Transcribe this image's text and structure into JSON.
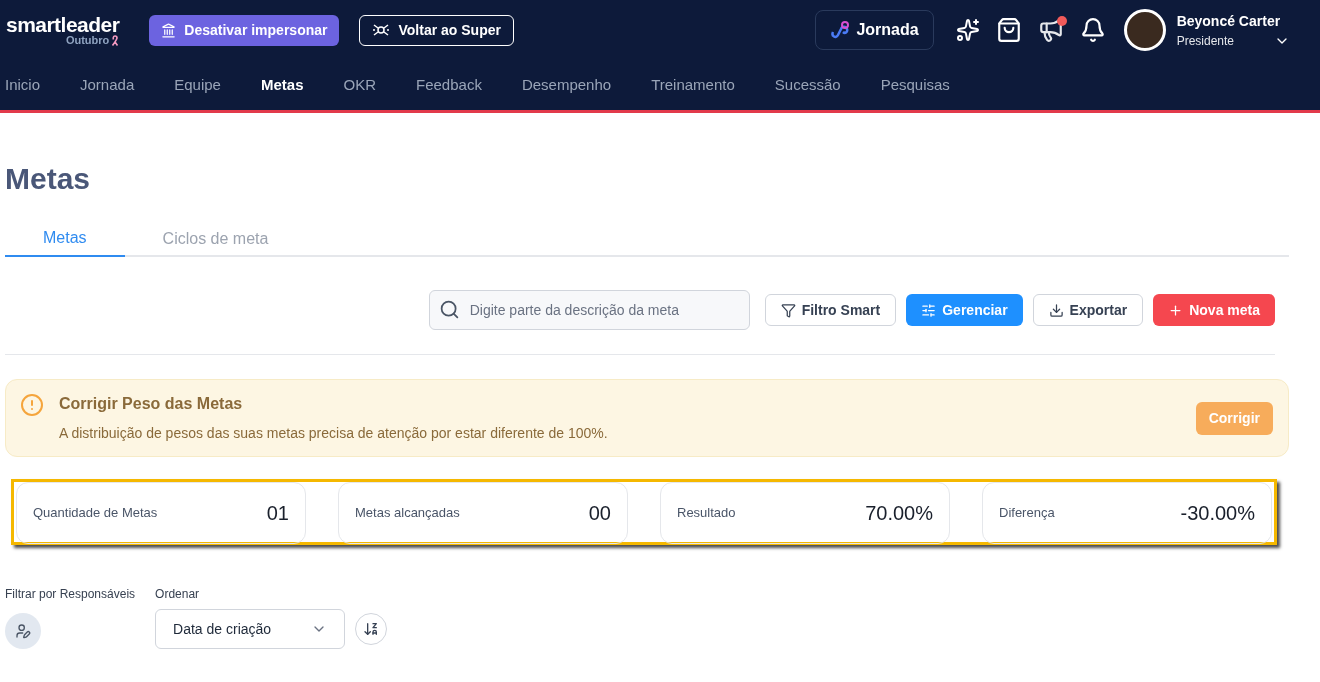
{
  "header": {
    "logo": "smartleader",
    "month": "Outubro",
    "buttons": [
      {
        "label": "Desativar impersonar",
        "kind": "primary"
      },
      {
        "label": "Voltar ao Super",
        "kind": "outline"
      }
    ],
    "journey_button": "Jornada",
    "announcement_unread": true,
    "user": {
      "name": "Beyoncé Carter",
      "role": "Presidente"
    }
  },
  "nav": [
    {
      "label": "Inicio",
      "selected": false
    },
    {
      "label": "Jornada",
      "selected": false
    },
    {
      "label": "Equipe",
      "selected": false
    },
    {
      "label": "Metas",
      "selected": true
    },
    {
      "label": "OKR",
      "selected": false
    },
    {
      "label": "Feedback",
      "selected": false
    },
    {
      "label": "Desempenho",
      "selected": false
    },
    {
      "label": "Treinamento",
      "selected": false
    },
    {
      "label": "Sucessão",
      "selected": false
    },
    {
      "label": "Pesquisas",
      "selected": false
    }
  ],
  "page_title": "Metas",
  "tabs": [
    {
      "label": "Metas",
      "selected": true
    },
    {
      "label": "Ciclos de meta",
      "selected": false
    }
  ],
  "toolbar": {
    "search": {
      "placeholder": "Digite parte da descrição da meta"
    },
    "buttons": [
      {
        "label": "Filtro Smart",
        "kind": "filter"
      },
      {
        "label": "Gerenciar",
        "kind": "manage"
      },
      {
        "label": "Exportar",
        "kind": "export"
      },
      {
        "label": "Nova meta",
        "kind": "new"
      }
    ]
  },
  "alert": {
    "title": "Corrigir Peso das Metas",
    "message": "A distribuição de pesos das suas metas precisa de atenção por estar diferente de 100%.",
    "button": "Corrigir"
  },
  "stats": [
    {
      "label": "Quantidade de Metas",
      "value": "01"
    },
    {
      "label": "Metas alcançadas",
      "value": "00"
    },
    {
      "label": "Resultado",
      "value": "70.00%"
    },
    {
      "label": "Diferença",
      "value": "-30.00%"
    }
  ],
  "filters": {
    "responsible_label": "Filtrar por Responsáveis",
    "order_label": "Ordenar",
    "order_value": "Data de criação"
  }
}
